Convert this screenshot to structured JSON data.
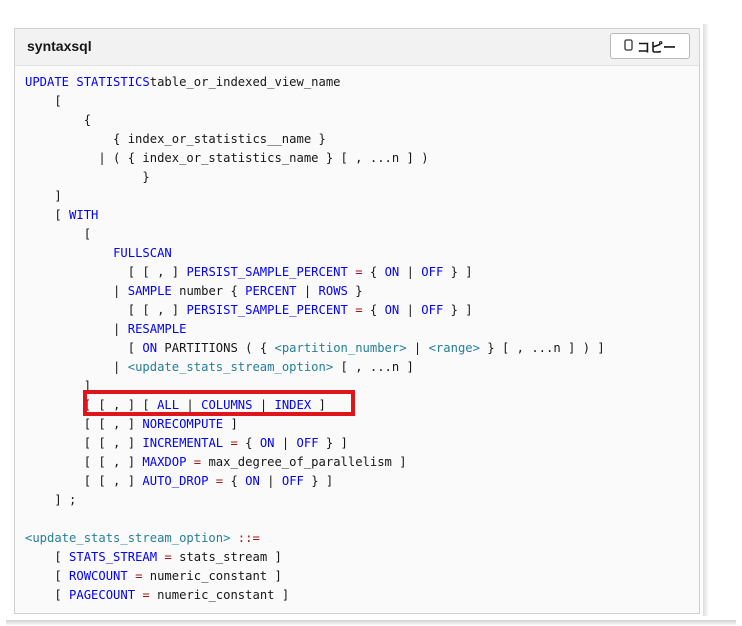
{
  "header": {
    "language_label": "syntaxsql",
    "copy_label": "コピー",
    "copy_icon": "copy-icon"
  },
  "colors": {
    "keyword": "#0101fd",
    "type": "#267f99",
    "operator": "#a31515",
    "plain": "#171717",
    "highlight": "#e0141b"
  },
  "code_lines": [
    [
      [
        "kw",
        "UPDATE STATISTICS"
      ],
      [
        "",
        "table_or_indexed_view_name"
      ]
    ],
    [
      [
        "",
        "    ["
      ]
    ],
    [
      [
        "",
        "        {"
      ]
    ],
    [
      [
        "",
        "            { index_or_statistics__name }"
      ]
    ],
    [
      [
        "",
        "          | ( { index_or_statistics_name } [ , ...n ] )"
      ]
    ],
    [
      [
        "",
        "                }"
      ]
    ],
    [
      [
        "",
        "    ]"
      ]
    ],
    [
      [
        "",
        "    [ "
      ],
      [
        "kw",
        "WITH"
      ]
    ],
    [
      [
        "",
        "        ["
      ]
    ],
    [
      [
        "",
        "            "
      ],
      [
        "kw",
        "FULLSCAN"
      ]
    ],
    [
      [
        "",
        "              [ [ , ] "
      ],
      [
        "kw",
        "PERSIST_SAMPLE_PERCENT"
      ],
      [
        "op",
        " = "
      ],
      [
        "",
        "{ "
      ],
      [
        "kw",
        "ON"
      ],
      [
        "",
        " | "
      ],
      [
        "kw",
        "OFF"
      ],
      [
        "",
        " } ]"
      ]
    ],
    [
      [
        "",
        "            | "
      ],
      [
        "kw",
        "SAMPLE"
      ],
      [
        "",
        " number { "
      ],
      [
        "kw",
        "PERCENT"
      ],
      [
        "",
        " | "
      ],
      [
        "kw",
        "ROWS"
      ],
      [
        "",
        " }"
      ]
    ],
    [
      [
        "",
        "              [ [ , ] "
      ],
      [
        "kw",
        "PERSIST_SAMPLE_PERCENT"
      ],
      [
        "op",
        " = "
      ],
      [
        "",
        "{ "
      ],
      [
        "kw",
        "ON"
      ],
      [
        "",
        " | "
      ],
      [
        "kw",
        "OFF"
      ],
      [
        "",
        " } ]"
      ]
    ],
    [
      [
        "",
        "            | "
      ],
      [
        "kw",
        "RESAMPLE"
      ]
    ],
    [
      [
        "",
        "              [ "
      ],
      [
        "kw",
        "ON"
      ],
      [
        "",
        " PARTITIONS ( { "
      ],
      [
        "tp",
        "<partition_number>"
      ],
      [
        "",
        " | "
      ],
      [
        "tp",
        "<range>"
      ],
      [
        "",
        " } [ , ...n ] ) ]"
      ]
    ],
    [
      [
        "",
        "            | "
      ],
      [
        "tp",
        "<update_stats_stream_option>"
      ],
      [
        "",
        " [ , ...n ]"
      ]
    ],
    [
      [
        "",
        "        ]"
      ]
    ],
    [
      [
        "",
        "        [ [ , ] [ "
      ],
      [
        "kw",
        "ALL"
      ],
      [
        "",
        " | "
      ],
      [
        "kw",
        "COLUMNS"
      ],
      [
        "",
        " | "
      ],
      [
        "kw",
        "INDEX"
      ],
      [
        "",
        " ]"
      ]
    ],
    [
      [
        "",
        "        [ [ , ] "
      ],
      [
        "kw",
        "NORECOMPUTE"
      ],
      [
        "",
        " ]"
      ]
    ],
    [
      [
        "",
        "        [ [ , ] "
      ],
      [
        "kw",
        "INCREMENTAL"
      ],
      [
        "op",
        " = "
      ],
      [
        "",
        "{ "
      ],
      [
        "kw",
        "ON"
      ],
      [
        "",
        " | "
      ],
      [
        "kw",
        "OFF"
      ],
      [
        "",
        " } ]"
      ]
    ],
    [
      [
        "",
        "        [ [ , ] "
      ],
      [
        "kw",
        "MAXDOP"
      ],
      [
        "op",
        " = "
      ],
      [
        "",
        "max_degree_of_parallelism ]"
      ]
    ],
    [
      [
        "",
        "        [ [ , ] "
      ],
      [
        "kw",
        "AUTO_DROP"
      ],
      [
        "op",
        " = "
      ],
      [
        "",
        "{ "
      ],
      [
        "kw",
        "ON"
      ],
      [
        "",
        " | "
      ],
      [
        "kw",
        "OFF"
      ],
      [
        "",
        " } ]"
      ]
    ],
    [
      [
        "",
        "    ] ;"
      ]
    ],
    [
      [
        "",
        ""
      ]
    ],
    [
      [
        "tp",
        "<update_stats_stream_option>"
      ],
      [
        "op",
        " ::="
      ]
    ],
    [
      [
        "",
        "    [ "
      ],
      [
        "kw",
        "STATS_STREAM"
      ],
      [
        "op",
        " = "
      ],
      [
        "",
        "stats_stream ]"
      ]
    ],
    [
      [
        "",
        "    [ "
      ],
      [
        "kw",
        "ROWCOUNT"
      ],
      [
        "op",
        " = "
      ],
      [
        "",
        "numeric_constant ]"
      ]
    ],
    [
      [
        "",
        "    [ "
      ],
      [
        "kw",
        "PAGECOUNT"
      ],
      [
        "op",
        " = "
      ],
      [
        "",
        "numeric_constant ]"
      ]
    ]
  ]
}
